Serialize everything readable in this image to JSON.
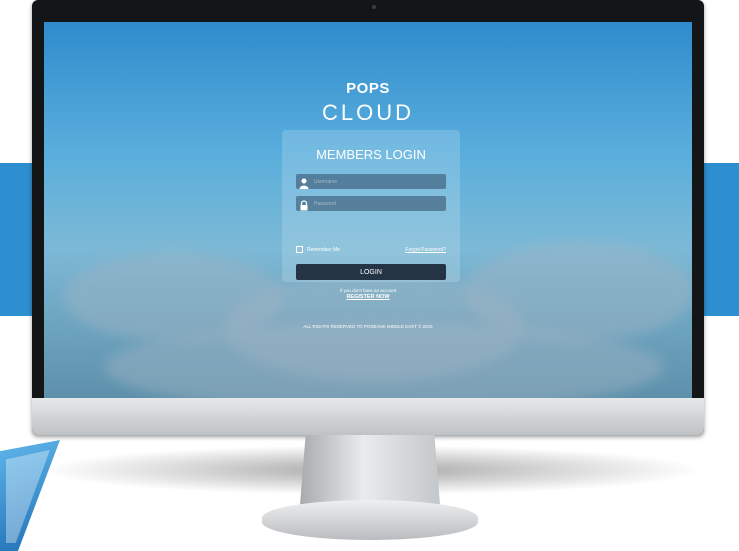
{
  "brand": {
    "logo_top": "POPS",
    "logo_bottom": "CLOUD"
  },
  "login": {
    "title": "MEMBERS LOGIN",
    "username_placeholder": "Username",
    "password_placeholder": "Password",
    "remember_label": "Remember Me",
    "forgot_label": "Forgot Password?",
    "button_label": "LOGIN"
  },
  "register": {
    "prompt": "If you don't have an account",
    "link_label": "REGISTER NOW"
  },
  "footer": {
    "copyright": "ALL RIGHTS RESERVED TO POSBANK MIDDLE EAST © 2015"
  },
  "colors": {
    "accent_band": "#2e8fd0",
    "button_bg": "#243445"
  },
  "icons": {
    "username": "user-icon",
    "password": "lock-icon"
  }
}
